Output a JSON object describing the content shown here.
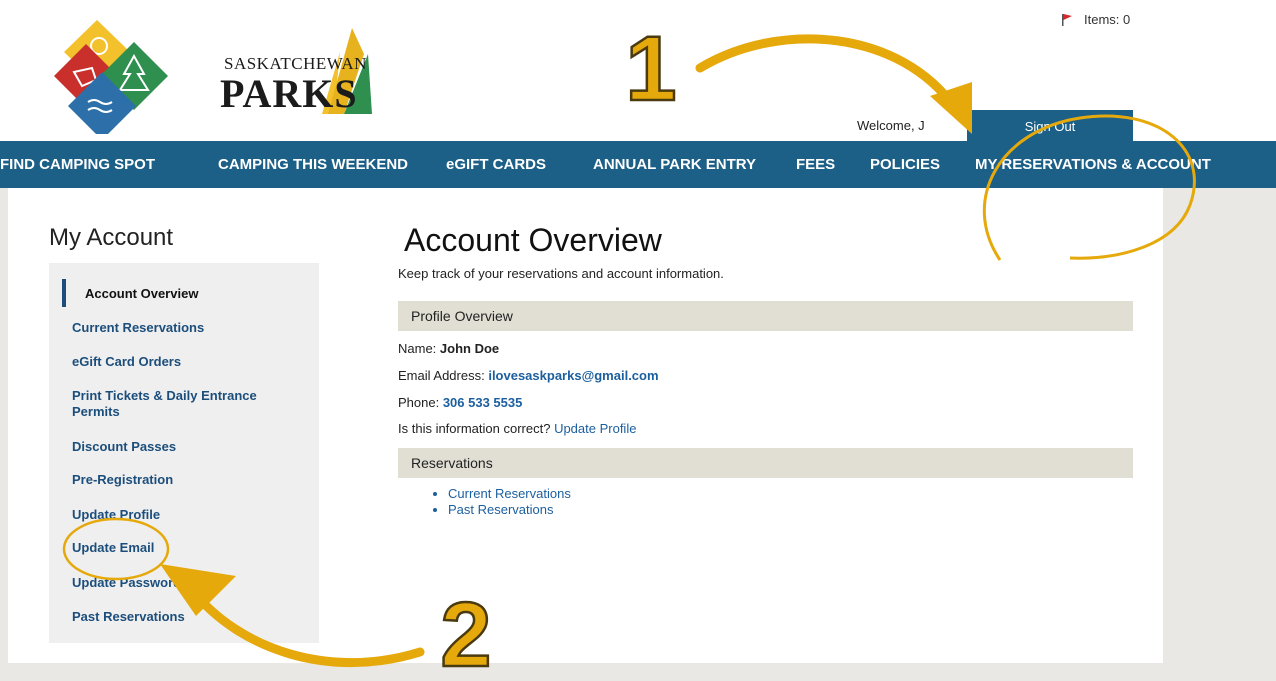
{
  "header": {
    "logo_top": "SASKATCHEWAN",
    "logo_main": "PARKS",
    "cart_label": "Items: 0",
    "welcome_text": "Welcome, J",
    "sign_out": "Sign Out"
  },
  "nav": [
    {
      "label": "FIND CAMPING SPOT"
    },
    {
      "label": "CAMPING THIS WEEKEND"
    },
    {
      "label": "eGIFT CARDS"
    },
    {
      "label": "ANNUAL PARK ENTRY"
    },
    {
      "label": "FEES"
    },
    {
      "label": "POLICIES"
    },
    {
      "label": "MY RESERVATIONS & ACCOUNT"
    }
  ],
  "sidebar": {
    "title": "My Account",
    "items": [
      {
        "label": "Account Overview"
      },
      {
        "label": "Current Reservations"
      },
      {
        "label": "eGift Card Orders"
      },
      {
        "label": "Print Tickets & Daily Entrance"
      },
      {
        "label": "Permits"
      },
      {
        "label": "Discount Passes"
      },
      {
        "label": "Pre-Registration"
      },
      {
        "label": "Update Profile"
      },
      {
        "label": "Update Email"
      },
      {
        "label": "Update Password"
      },
      {
        "label": "Past Reservations"
      }
    ]
  },
  "main": {
    "title": "Account Overview",
    "subtitle": "Keep track of your reservations and account information.",
    "profile_header": "Profile Overview",
    "name_label": "Name: ",
    "name_value": "John Doe",
    "email_label": "Email Address: ",
    "email_value": "ilovesaskparks@gmail.com",
    "phone_label": "Phone: ",
    "phone_value": "306 533 5535",
    "correct_question": "Is this information correct? ",
    "update_profile_link": "Update Profile",
    "reservations_header": "Reservations",
    "reservation_links": [
      {
        "label": "Current Reservations"
      },
      {
        "label": "Past Reservations"
      }
    ]
  },
  "annotations": {
    "step1": "1",
    "step2": "2"
  },
  "colors": {
    "nav_blue": "#1c5f87",
    "link_blue": "#1c5f9e",
    "annotation_gold": "#e6a90c",
    "section_bar": "#e1dfd4"
  }
}
